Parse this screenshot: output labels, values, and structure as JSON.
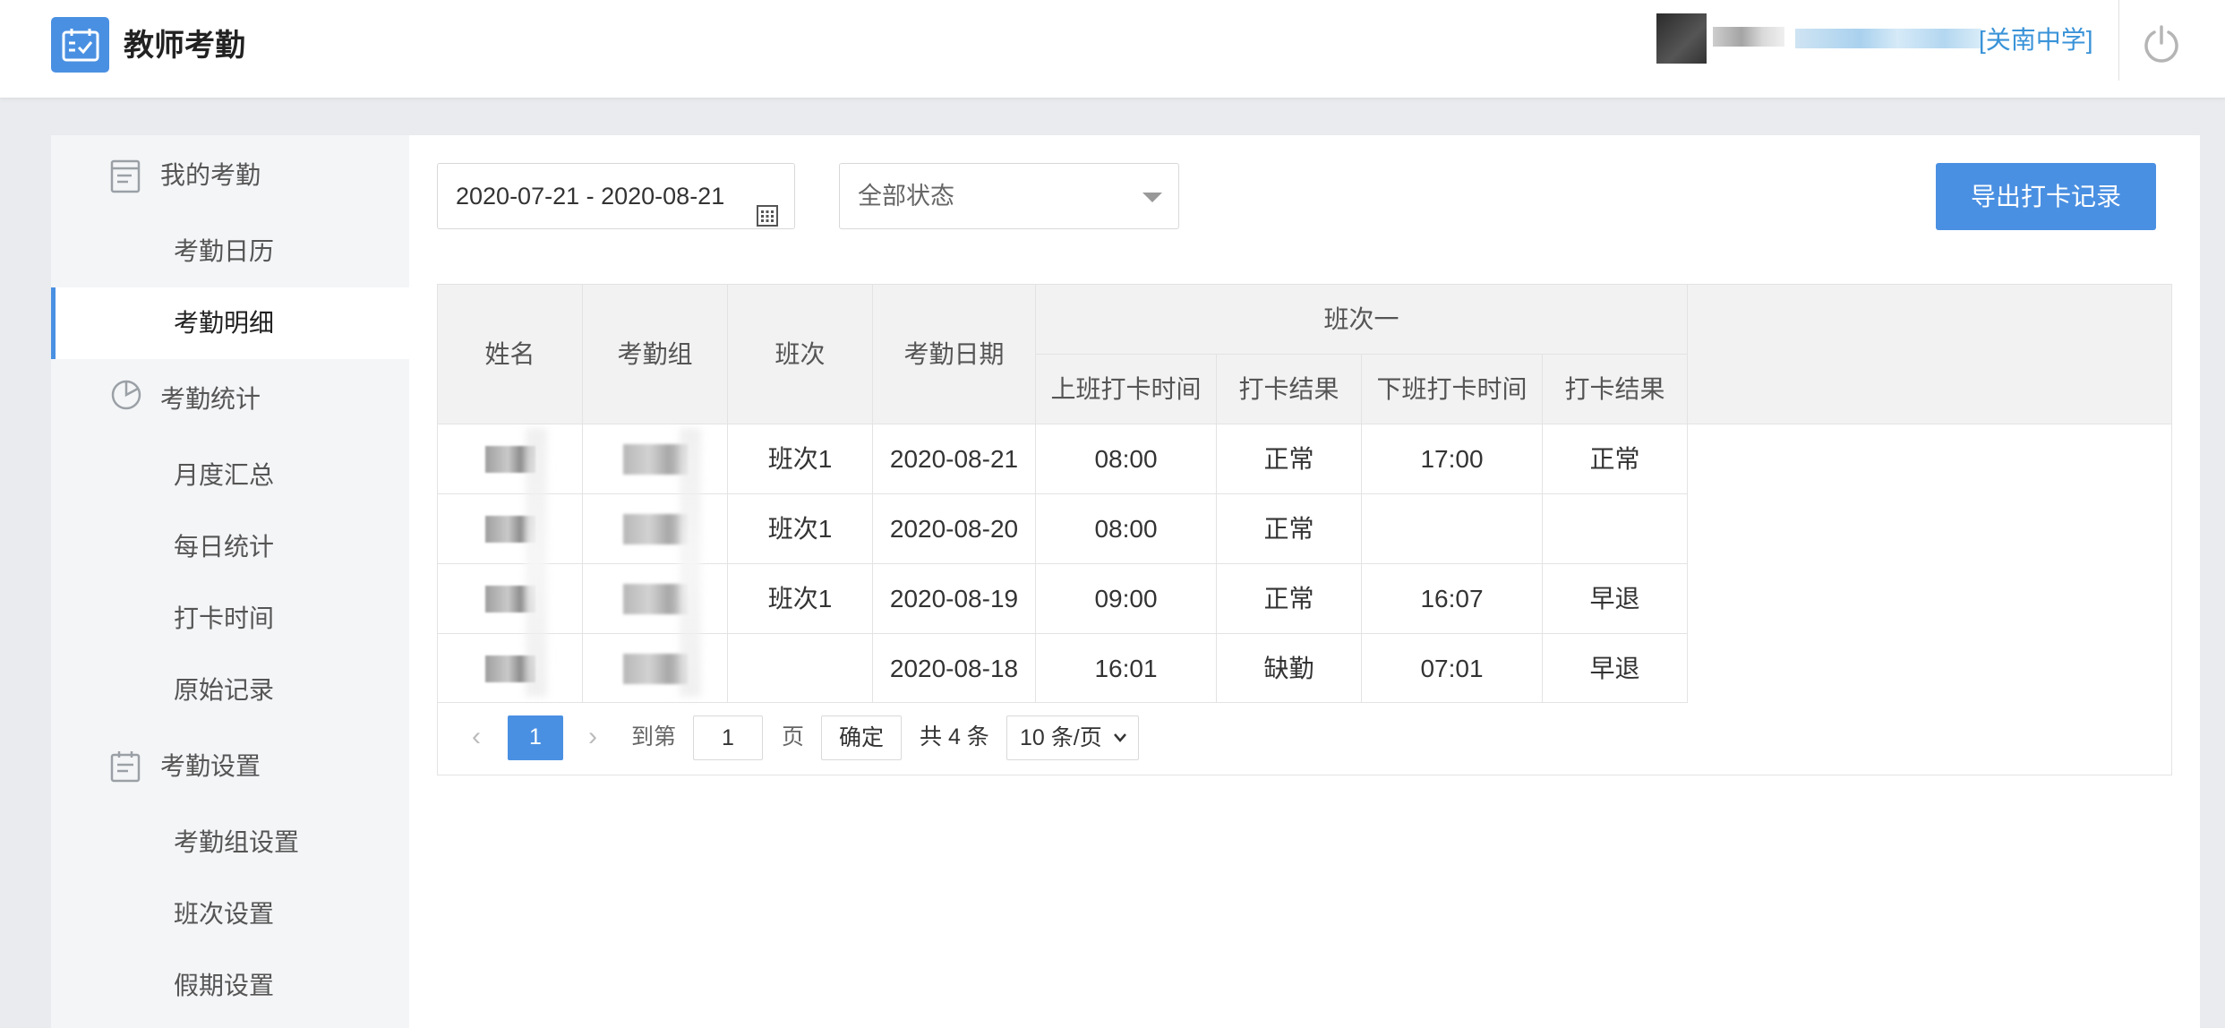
{
  "app": {
    "title": "教师考勤",
    "school_name": "[关南中学]",
    "accent_color": "#4a90e2",
    "logo_icon": "calendar-check-icon",
    "power_icon": "power-icon"
  },
  "sidebar": {
    "groups": [
      {
        "label": "我的考勤",
        "icon": "document-icon",
        "items": [
          {
            "label": "考勤日历",
            "active": false
          },
          {
            "label": "考勤明细",
            "active": true
          }
        ]
      },
      {
        "label": "考勤统计",
        "icon": "pie-chart-icon",
        "items": [
          {
            "label": "月度汇总",
            "active": false
          },
          {
            "label": "每日统计",
            "active": false
          },
          {
            "label": "打卡时间",
            "active": false
          },
          {
            "label": "原始记录",
            "active": false
          }
        ]
      },
      {
        "label": "考勤设置",
        "icon": "settings-doc-icon",
        "items": [
          {
            "label": "考勤组设置",
            "active": false
          },
          {
            "label": "班次设置",
            "active": false
          },
          {
            "label": "假期设置",
            "active": false
          }
        ]
      }
    ]
  },
  "filters": {
    "date_range": "2020-07-21 - 2020-08-21",
    "status": "全部状态",
    "export_label": "导出打卡记录"
  },
  "table": {
    "headers": {
      "name": "姓名",
      "group": "考勤组",
      "shift": "班次",
      "date": "考勤日期",
      "shift_group": "班次一",
      "in_time": "上班打卡时间",
      "in_result": "打卡结果",
      "out_time": "下班打卡时间",
      "out_result": "打卡结果"
    },
    "rows": [
      {
        "shift": "班次1",
        "date": "2020-08-21",
        "in_time": "08:00",
        "in_result": "正常",
        "out_time": "17:00",
        "out_result": "正常"
      },
      {
        "shift": "班次1",
        "date": "2020-08-20",
        "in_time": "08:00",
        "in_result": "正常",
        "out_time": "",
        "out_result": ""
      },
      {
        "shift": "班次1",
        "date": "2020-08-19",
        "in_time": "09:00",
        "in_result": "正常",
        "out_time": "16:07",
        "out_result": "早退"
      },
      {
        "shift": "",
        "date": "2020-08-18",
        "in_time": "16:01",
        "in_result": "缺勤",
        "out_time": "07:01",
        "out_result": "早退"
      }
    ]
  },
  "pagination": {
    "prev": "‹",
    "next": "›",
    "current_page": "1",
    "goto_label": "到第",
    "goto_value": "1",
    "page_unit": "页",
    "confirm_label": "确定",
    "total_text": "共 4 条",
    "page_size": "10 条/页"
  }
}
